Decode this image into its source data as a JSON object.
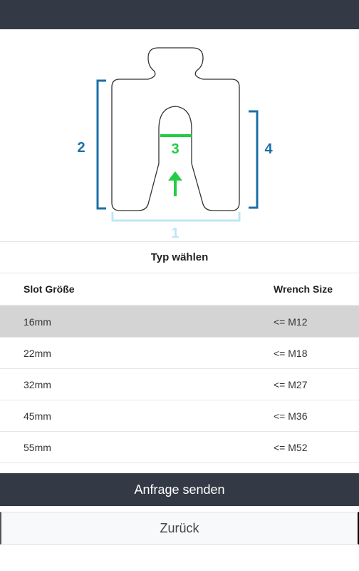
{
  "diagram": {
    "labels": [
      "1",
      "2",
      "3",
      "4"
    ],
    "colors": {
      "dim_1": "#bfe6f7",
      "dim_2_4": "#1b6fa8",
      "dim_3": "#22cc44",
      "outline": "#333333"
    }
  },
  "section_title": "Typ wählen",
  "table": {
    "headers": [
      "Slot Größe",
      "Wrench Size"
    ],
    "rows": [
      {
        "slot": "16mm",
        "wrench": "<= M12",
        "selected": true
      },
      {
        "slot": "22mm",
        "wrench": "<= M18",
        "selected": false
      },
      {
        "slot": "32mm",
        "wrench": "<= M27",
        "selected": false
      },
      {
        "slot": "45mm",
        "wrench": "<= M36",
        "selected": false
      },
      {
        "slot": "55mm",
        "wrench": "<= M52",
        "selected": false
      }
    ]
  },
  "buttons": {
    "submit": "Anfrage senden",
    "back": "Zurück"
  }
}
